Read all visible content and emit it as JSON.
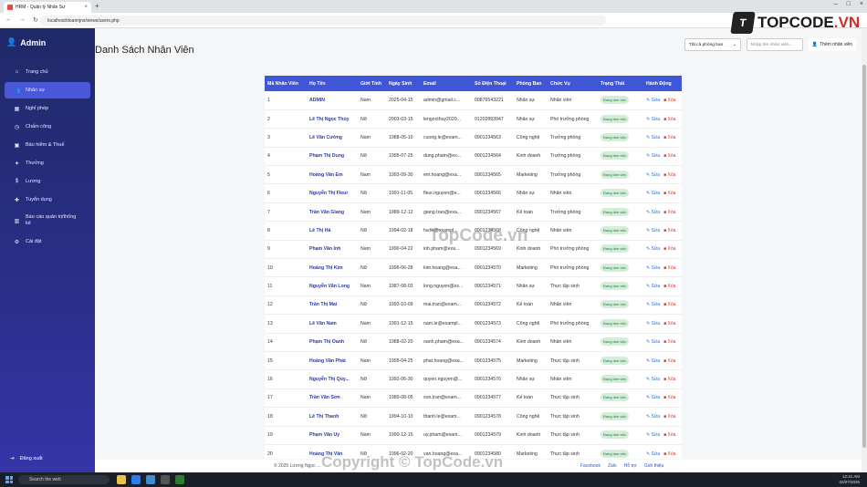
{
  "browser": {
    "tab_title": "HRM - Quản lý Nhân Sự",
    "url": "localhost/doannjns/views/users.php"
  },
  "sidebar": {
    "brand": "Admin",
    "items": [
      {
        "label": "Trang chủ",
        "icon": "home-icon",
        "glyph": "⌂"
      },
      {
        "label": "Nhân sự",
        "icon": "users-icon",
        "glyph": "👥"
      },
      {
        "label": "Nghỉ phép",
        "icon": "calendar-icon",
        "glyph": "▦"
      },
      {
        "label": "Chấm công",
        "icon": "clock-icon",
        "glyph": "◷"
      },
      {
        "label": "Bảo hiểm & Thuế",
        "icon": "shield-icon",
        "glyph": "▣"
      },
      {
        "label": "Thưởng",
        "icon": "gift-icon",
        "glyph": "✦"
      },
      {
        "label": "Lương",
        "icon": "money-icon",
        "glyph": "$"
      },
      {
        "label": "Tuyển dụng",
        "icon": "user-plus-icon",
        "glyph": "✚"
      },
      {
        "label": "Báo cáo quản trị/thống kê",
        "icon": "chart-icon",
        "glyph": "▥"
      },
      {
        "label": "Cài đặt",
        "icon": "gear-icon",
        "glyph": "⚙"
      }
    ],
    "logout": "Đăng xuất"
  },
  "header": {
    "title": "Danh Sách Nhân Viên",
    "department_filter": "Tất cả phòng ban",
    "search_placeholder": "Nhập tên nhân viên...",
    "add_label": "Thêm nhân viên"
  },
  "table": {
    "columns": [
      "Mã Nhân Viên",
      "Họ Tên",
      "Giới Tính",
      "Ngày Sinh",
      "Email",
      "Số Điện Thoại",
      "Phòng Ban",
      "Chức Vụ",
      "Trạng Thái",
      "Hành Động"
    ],
    "edit_label": "Sửa",
    "delete_label": "Xóa",
    "rows": [
      {
        "id": "1",
        "name": "ADMIN",
        "gender": "Nam",
        "dob": "2025-04-15",
        "email": "admin@gmail.c...",
        "phone": "09876543221",
        "dept": "Nhân sự",
        "position": "Nhân viên",
        "status": "Đang làm việc"
      },
      {
        "id": "2",
        "name": "Lê Thị Ngọc Thủy",
        "gender": "Nữ",
        "dob": "2003-03-15",
        "email": "lengocthuy2020...",
        "phone": "01202893947",
        "dept": "Nhân sự",
        "position": "Phó trưởng phòng",
        "status": "Đang làm việc"
      },
      {
        "id": "3",
        "name": "Lê Văn Cường",
        "gender": "Nam",
        "dob": "1988-05-10",
        "email": "cuong.le@exam...",
        "phone": "0901234563",
        "dept": "Công nghệ",
        "position": "Trưởng phòng",
        "status": "Đang làm việc"
      },
      {
        "id": "4",
        "name": "Phạm Thị Dung",
        "gender": "Nữ",
        "dob": "1995-07-25",
        "email": "dung.pham@ex...",
        "phone": "0901234564",
        "dept": "Kinh doanh",
        "position": "Trưởng phòng",
        "status": "Đang làm việc"
      },
      {
        "id": "5",
        "name": "Hoàng Văn Em",
        "gender": "Nam",
        "dob": "1993-09-30",
        "email": "em.hoang@exa...",
        "phone": "0901234565",
        "dept": "Marketing",
        "position": "Trưởng phòng",
        "status": "Đang làm việc"
      },
      {
        "id": "6",
        "name": "Nguyễn Thị Fleur",
        "gender": "Nữ",
        "dob": "1991-11-05",
        "email": "fleur.nguyen@e...",
        "phone": "0901234566",
        "dept": "Nhân sự",
        "position": "Nhân viên",
        "status": "Đang làm việc"
      },
      {
        "id": "7",
        "name": "Trần Văn Giang",
        "gender": "Nam",
        "dob": "1989-12-12",
        "email": "giang.tran@exa...",
        "phone": "0901234567",
        "dept": "Kế toán",
        "position": "Trưởng phòng",
        "status": "Đang làm việc"
      },
      {
        "id": "8",
        "name": "Lê Thị Hà",
        "gender": "Nữ",
        "dob": "1994-02-18",
        "email": "ha.le@exampl...",
        "phone": "0901234568",
        "dept": "Công nghệ",
        "position": "Nhân viên",
        "status": "Đang làm việc"
      },
      {
        "id": "9",
        "name": "Phạm Văn Inh",
        "gender": "Nam",
        "dob": "1990-04-22",
        "email": "inh.pham@exa...",
        "phone": "0901234569",
        "dept": "Kinh doanh",
        "position": "Phó trưởng phòng",
        "status": "Đang làm việc"
      },
      {
        "id": "10",
        "name": "Hoàng Thị Kim",
        "gender": "Nữ",
        "dob": "1996-06-28",
        "email": "kim.hoang@exa...",
        "phone": "0901234570",
        "dept": "Marketing",
        "position": "Phó trưởng phòng",
        "status": "Đang làm việc"
      },
      {
        "id": "11",
        "name": "Nguyễn Văn Long",
        "gender": "Nam",
        "dob": "1987-08-03",
        "email": "long.nguyen@ex...",
        "phone": "0901234571",
        "dept": "Nhân sự",
        "position": "Thực tập sinh",
        "status": "Đang làm việc"
      },
      {
        "id": "12",
        "name": "Trần Thị Mai",
        "gender": "Nữ",
        "dob": "1993-10-09",
        "email": "mai.tran@exam...",
        "phone": "0901234572",
        "dept": "Kế toán",
        "position": "Nhân viên",
        "status": "Đang làm việc"
      },
      {
        "id": "13",
        "name": "Lê Văn Nam",
        "gender": "Nam",
        "dob": "1991-12-15",
        "email": "nam.le@exampl...",
        "phone": "0901234573",
        "dept": "Công nghệ",
        "position": "Phó trưởng phòng",
        "status": "Đang làm việc"
      },
      {
        "id": "14",
        "name": "Phạm Thị Oanh",
        "gender": "Nữ",
        "dob": "1988-02-20",
        "email": "oanh.pham@exa...",
        "phone": "0901234574",
        "dept": "Kinh doanh",
        "position": "Nhân viên",
        "status": "Đang làm việc"
      },
      {
        "id": "15",
        "name": "Hoàng Văn Phát",
        "gender": "Nam",
        "dob": "1995-04-25",
        "email": "phat.hoang@exa...",
        "phone": "0901234575",
        "dept": "Marketing",
        "position": "Thực tập sinh",
        "status": "Đang làm việc"
      },
      {
        "id": "16",
        "name": "Nguyễn Thị Quy...",
        "gender": "Nữ",
        "dob": "1992-06-30",
        "email": "quyen.nguyen@...",
        "phone": "0901234576",
        "dept": "Nhân sự",
        "position": "Nhân viên",
        "status": "Đang làm việc"
      },
      {
        "id": "17",
        "name": "Trần Văn Sơn",
        "gender": "Nam",
        "dob": "1989-08-05",
        "email": "son.tran@exam...",
        "phone": "0901234577",
        "dept": "Kế toán",
        "position": "Thực tập sinh",
        "status": "Đang làm việc"
      },
      {
        "id": "18",
        "name": "Lê Thị Thanh",
        "gender": "Nữ",
        "dob": "1994-10-10",
        "email": "thanh.le@exam...",
        "phone": "0901234578",
        "dept": "Công nghệ",
        "position": "Thực tập sinh",
        "status": "Đang làm việc"
      },
      {
        "id": "19",
        "name": "Phạm Văn Uy",
        "gender": "Nam",
        "dob": "1990-12-15",
        "email": "uy.pham@exam...",
        "phone": "0901234579",
        "dept": "Kinh doanh",
        "position": "Thực tập sinh",
        "status": "Đang làm việc"
      },
      {
        "id": "20",
        "name": "Hoàng Thị Vân",
        "gender": "Nữ",
        "dob": "1996-02-20",
        "email": "van.hoang@exa...",
        "phone": "0901234580",
        "dept": "Marketing",
        "position": "Thực tập sinh",
        "status": "Đang làm việc"
      }
    ]
  },
  "footer": {
    "copyright": "© 2025 Lương Ngọc ...",
    "links": [
      "Facebook",
      "Zalo",
      "Hỗ trợ",
      "Giới thiệu"
    ]
  },
  "taskbar": {
    "search": "Search the web",
    "time": "12:41 AM",
    "date": "02/07/2025"
  },
  "logo": {
    "mark": "T",
    "text_main": "TOPCODE",
    "text_accent": ".VN"
  },
  "watermarks": {
    "center": "TopCode.vn",
    "bottom": "Copyright © TopCode.vn"
  }
}
